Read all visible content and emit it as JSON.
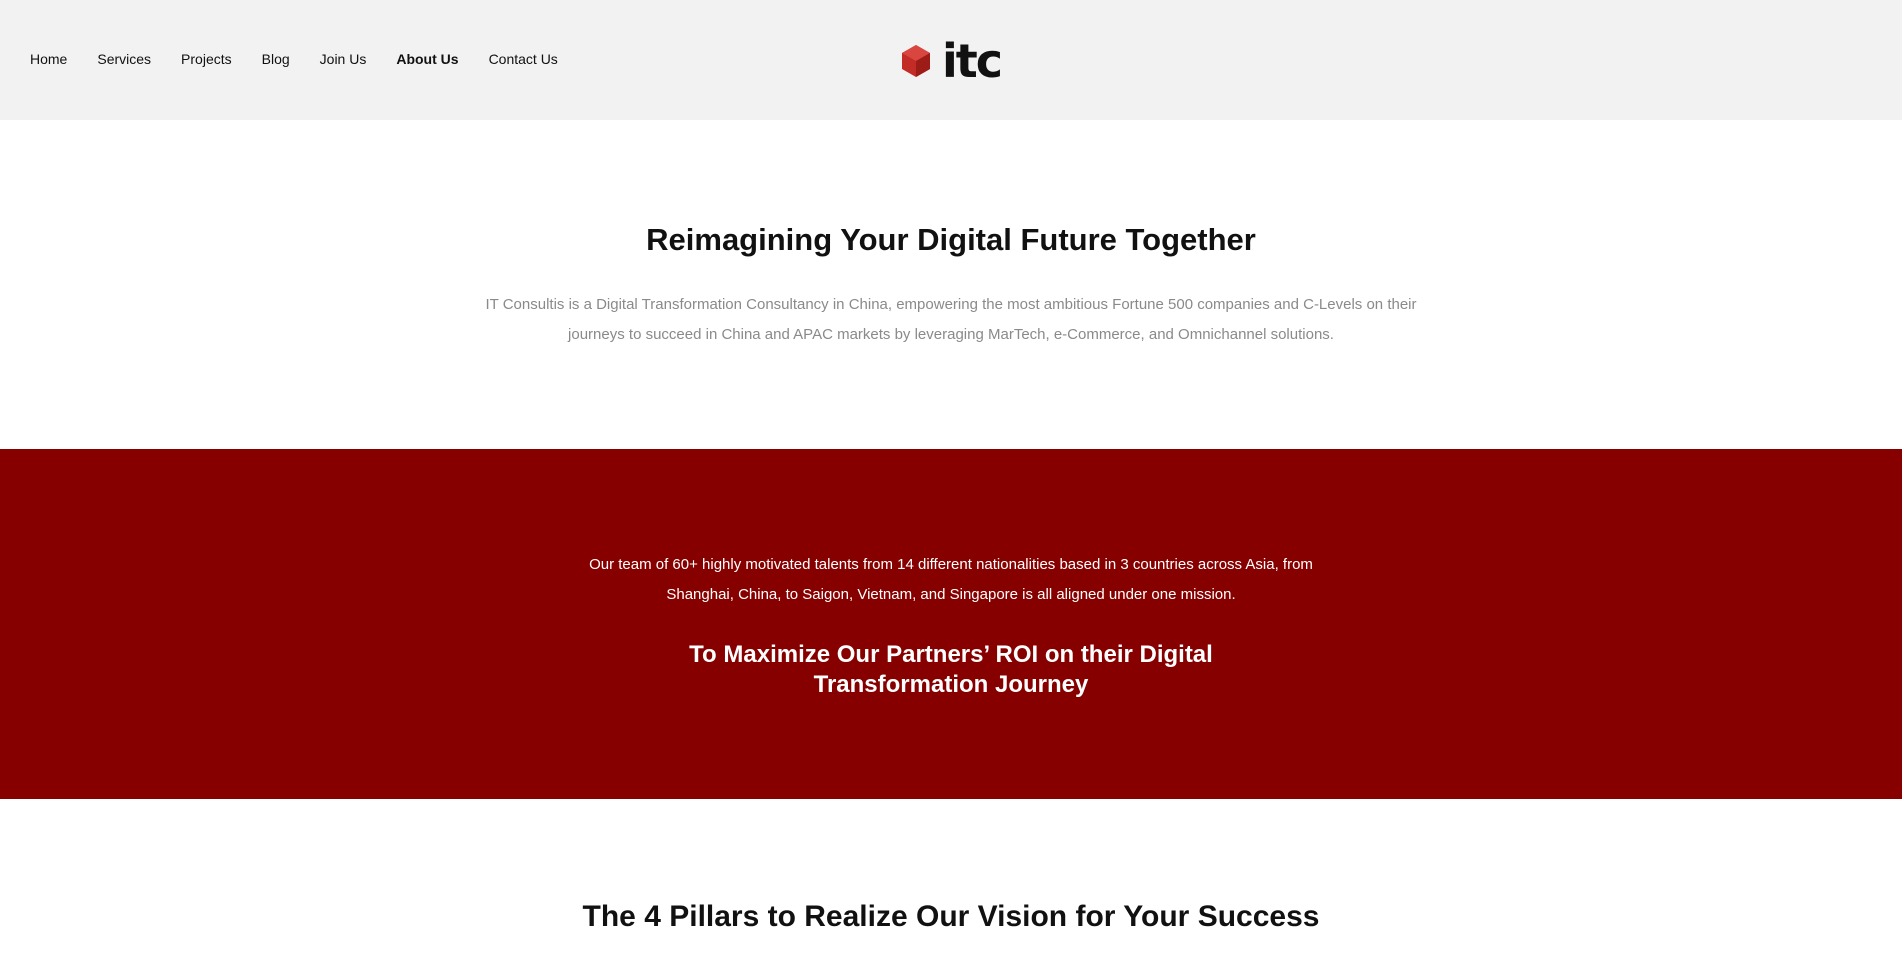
{
  "header": {
    "nav": [
      {
        "label": "Home"
      },
      {
        "label": "Services"
      },
      {
        "label": "Projects"
      },
      {
        "label": "Blog"
      },
      {
        "label": "Join Us"
      },
      {
        "label": "About Us",
        "active": true
      },
      {
        "label": "Contact Us"
      }
    ],
    "logo": {
      "text": "itc",
      "icon": "hexagon-logo-icon",
      "color": "#c22b26"
    }
  },
  "intro": {
    "title": "Reimagining Your Digital Future Together",
    "description": "IT Consultis is a Digital Transformation Consultancy in China, empowering the most ambitious Fortune 500 companies and C-Levels on their journeys to succeed in China and APAC markets by leveraging MarTech, e-Commerce, and Omnichannel solutions."
  },
  "mission": {
    "background_color": "#860000",
    "text": "Our team of 60+ highly motivated talents from 14 different nationalities based in 3 countries across Asia, from Shanghai, China, to Saigon, Vietnam, and Singapore is all aligned under one mission.",
    "headline": "To Maximize Our Partners’ ROI on their Digital Transformation Journey"
  },
  "pillars": {
    "title": "The 4 Pillars to Realize Our Vision for Your Success"
  }
}
